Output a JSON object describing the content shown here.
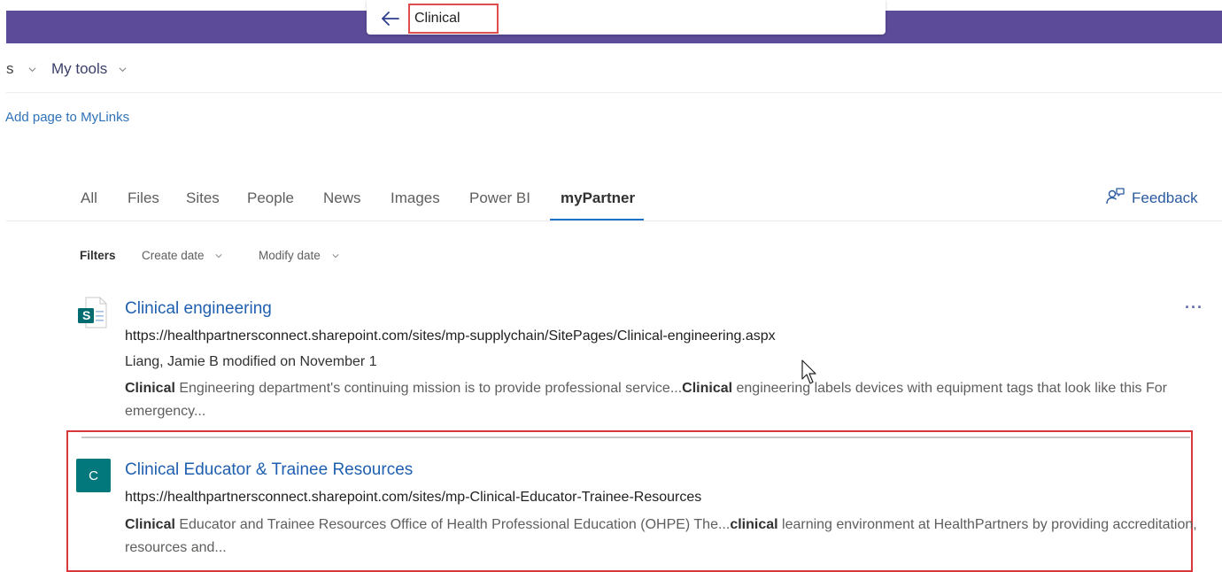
{
  "search": {
    "query": "Clinical"
  },
  "nav": {
    "partial_item": "s",
    "my_tools": "My tools"
  },
  "mylinks": "Add page to MyLinks",
  "tabs": [
    {
      "label": "All"
    },
    {
      "label": "Files"
    },
    {
      "label": "Sites"
    },
    {
      "label": "People"
    },
    {
      "label": "News"
    },
    {
      "label": "Images"
    },
    {
      "label": "Power BI"
    },
    {
      "label": "myPartner",
      "active": true
    }
  ],
  "feedback": {
    "label": "Feedback",
    "icon": "feedback-icon"
  },
  "filters": {
    "label": "Filters",
    "create_date": "Create date",
    "modify_date": "Modify date"
  },
  "results": [
    {
      "title": "Clinical engineering",
      "url": "https://healthpartnersconnect.sharepoint.com/sites/mp-supplychain/SitePages/Clinical-engineering.aspx",
      "meta": "Liang, Jamie B modified on November 1",
      "snippet": {
        "b1": "Clinical",
        "t1": " Engineering department's continuing mission is to provide professional service...",
        "b2": "Clinical",
        "t2": " engineering labels devices with equipment tags that look like this For emergency..."
      },
      "icon": "sharepoint-page-icon",
      "icon_letter": "S",
      "more": "···"
    },
    {
      "title": "Clinical Educator & Trainee Resources",
      "url": "https://healthpartnersconnect.sharepoint.com/sites/mp-Clinical-Educator-Trainee-Resources",
      "snippet": {
        "b1": "Clinical",
        "t1": " Educator and Trainee Resources Office of Health Professional Education (OHPE) The...",
        "b2": "clinical",
        "t2": " learning environment at HealthPartners by providing accreditation, resources and..."
      },
      "icon": "site-logo-icon",
      "icon_letter": "C"
    }
  ],
  "colors": {
    "suite_bar": "#5c4b99",
    "accent": "#1a73c7",
    "link": "#1f5faf",
    "highlight": "#d9383a",
    "site_icon": "#03787c"
  }
}
